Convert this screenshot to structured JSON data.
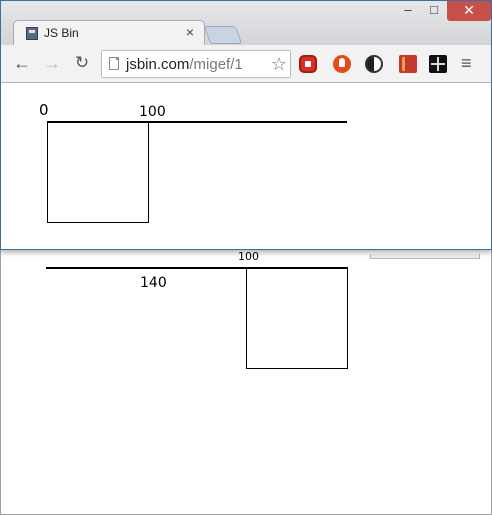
{
  "browser": {
    "tab": {
      "title": "JS Bin",
      "close": "×"
    },
    "url": {
      "host": "jsbin.com",
      "path": "/migef/1"
    },
    "window_controls": {
      "minimize": "–",
      "maximize": "□",
      "close": "✕"
    },
    "nav": {
      "back": "←",
      "forward": "→",
      "reload": "↻",
      "bookmark": "☆",
      "menu": "≡"
    },
    "extensions": [
      "adblock-icon",
      "ublock-icon",
      "contrast-icon",
      "book-icon",
      "grid-icon"
    ],
    "accent_color": "#c7504b"
  },
  "page": {
    "top_labels": {
      "left": "0",
      "right": "100"
    },
    "lower_labels": {
      "top": "100",
      "below_line": "140"
    }
  }
}
